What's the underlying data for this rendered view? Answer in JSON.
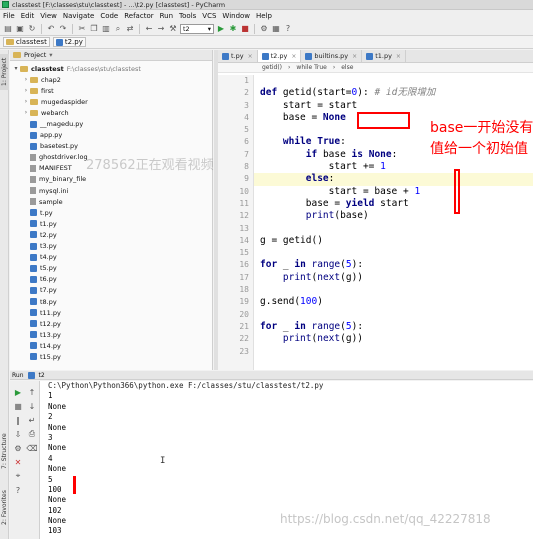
{
  "window": {
    "title": "classtest [F:\\classes\\stu\\classtest] - ...\\t2.py [classtest] - PyCharm"
  },
  "menu": [
    "File",
    "Edit",
    "View",
    "Navigate",
    "Code",
    "Refactor",
    "Run",
    "Tools",
    "VCS",
    "Window",
    "Help"
  ],
  "toolbar": {
    "run_config": "t2"
  },
  "nav": {
    "project": "classtest",
    "file": "t2.py"
  },
  "sidebar_strip": {
    "project": "1: Project",
    "structure": "7: Structure",
    "favorites": "2: Favorites"
  },
  "project_panel": {
    "header": "Project",
    "root": {
      "name": "classtest",
      "path": "F:\\classes\\stu\\classtest"
    },
    "items": [
      {
        "label": "chap2",
        "kind": "folder"
      },
      {
        "label": "first",
        "kind": "folder"
      },
      {
        "label": "mugedaspider",
        "kind": "folder"
      },
      {
        "label": "webarch",
        "kind": "folder"
      },
      {
        "label": "__magedu.py",
        "kind": "py"
      },
      {
        "label": "app.py",
        "kind": "py"
      },
      {
        "label": "basetest.py",
        "kind": "py"
      },
      {
        "label": "ghostdriver.log",
        "kind": "file"
      },
      {
        "label": "MANIFEST",
        "kind": "file"
      },
      {
        "label": "my_binary_file",
        "kind": "file"
      },
      {
        "label": "mysql.ini",
        "kind": "file"
      },
      {
        "label": "sample",
        "kind": "file"
      },
      {
        "label": "t.py",
        "kind": "py"
      },
      {
        "label": "t1.py",
        "kind": "py"
      },
      {
        "label": "t2.py",
        "kind": "py"
      },
      {
        "label": "t3.py",
        "kind": "py"
      },
      {
        "label": "t4.py",
        "kind": "py"
      },
      {
        "label": "t5.py",
        "kind": "py"
      },
      {
        "label": "t6.py",
        "kind": "py"
      },
      {
        "label": "t7.py",
        "kind": "py"
      },
      {
        "label": "t8.py",
        "kind": "py"
      },
      {
        "label": "t11.py",
        "kind": "py"
      },
      {
        "label": "t12.py",
        "kind": "py"
      },
      {
        "label": "t13.py",
        "kind": "py"
      },
      {
        "label": "t14.py",
        "kind": "py"
      },
      {
        "label": "t15.py",
        "kind": "py"
      }
    ]
  },
  "editor": {
    "tabs": [
      "t.py",
      "t2.py",
      "builtins.py",
      "t1.py"
    ],
    "active_tab": "t2.py",
    "breadcrumbs": [
      "getid()",
      "while True",
      "else"
    ],
    "line_numbers": [
      "1",
      "2",
      "3",
      "4",
      "5",
      "6",
      "7",
      "8",
      "9",
      "10",
      "11",
      "12",
      "13",
      "14",
      "15",
      "16",
      "17",
      "18",
      "19",
      "20",
      "21",
      "22",
      "23"
    ],
    "comment": "# id无限增加"
  },
  "annotation": {
    "text": "base一开始没有值给一个初始值"
  },
  "run_panel": {
    "header": "Run",
    "config": "t2",
    "command": "C:\\Python\\Python366\\python.exe F:/classes/stu/classtest/t2.py",
    "output": [
      "1",
      "None",
      "2",
      "None",
      "3",
      "None",
      "4",
      "None",
      "5",
      "100",
      "None",
      "102",
      "None",
      "103"
    ]
  },
  "watermarks": {
    "overlay": "278562正在观看视频",
    "site": "https://blog.csdn.net/qq_42227818"
  },
  "colors": {
    "annotation": "#ff0000",
    "keyword": "#000080",
    "number": "#0000ff",
    "comment": "#808080",
    "caret_row": "#fcfad6"
  }
}
